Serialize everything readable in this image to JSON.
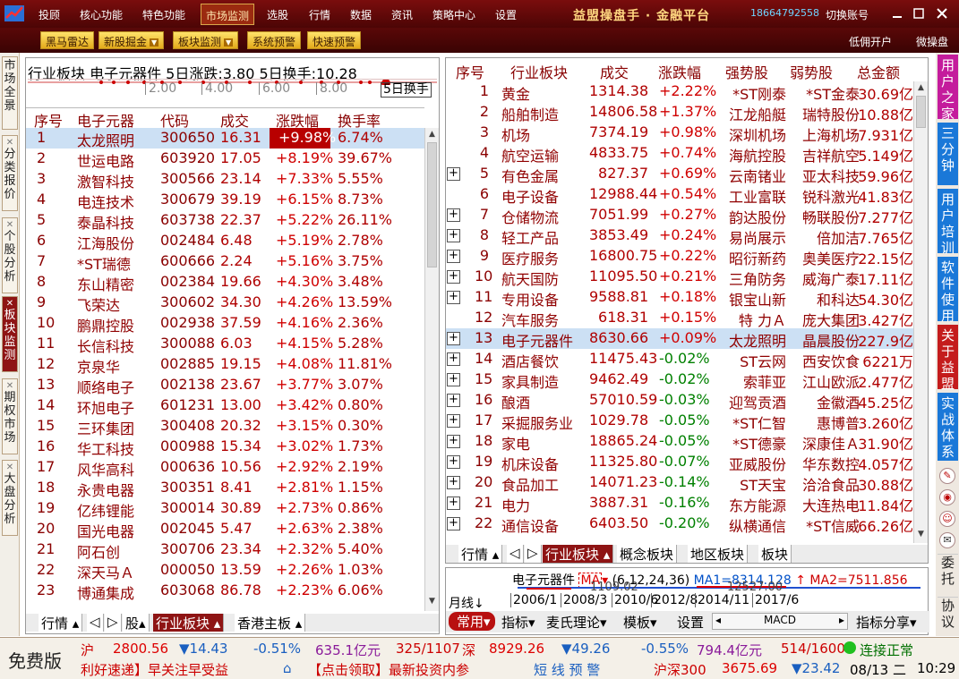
{
  "menubar": {
    "items": [
      "投顾",
      "核心功能",
      "特色功能",
      "市场监测",
      "选股",
      "行情",
      "数据",
      "资讯",
      "策略中心",
      "设置"
    ],
    "active": "市场监测",
    "brand": "益盟操盘手 · 金融平台",
    "phone": "18664792558",
    "account": "切换账号"
  },
  "toolbar": {
    "buttons": [
      "黑马雷达",
      "新股掘金",
      "板块监测",
      "系统预警",
      "快速预警"
    ],
    "right": [
      "低佣开户",
      "微操盘"
    ]
  },
  "left_tabs": [
    {
      "label": "市场全景",
      "active": false
    },
    {
      "label": "分类报价",
      "active": false
    },
    {
      "label": "个股分析",
      "active": false
    },
    {
      "label": "板块监测",
      "active": true
    },
    {
      "label": "期权市场",
      "active": false
    },
    {
      "label": "大盘分析",
      "active": false
    }
  ],
  "right_tabs": [
    "用户之家",
    "三分钟",
    "用户培训",
    "软件使用",
    "关于益盟",
    "实战体系"
  ],
  "right_bottom": [
    "委托",
    "协议"
  ],
  "left_panel": {
    "caption": "行业板块  电子元器件  5日涨跌:3.80  5日换手:10.28",
    "ticks": [
      "2.00",
      "4.00",
      "6.00",
      "8.00"
    ],
    "tick_label": "5日换手",
    "headers": [
      "序号",
      "电子元器",
      "代码",
      "成交",
      "涨跌幅",
      "换手率"
    ],
    "rows": [
      [
        "1",
        "太龙照明",
        "300650",
        "16.31",
        "+9.98%",
        "6.74%"
      ],
      [
        "2",
        "世运电路",
        "603920",
        "17.05",
        "+8.19%",
        "39.67%"
      ],
      [
        "3",
        "激智科技",
        "300566",
        "23.14",
        "+7.33%",
        "5.55%"
      ],
      [
        "4",
        "电连技术",
        "300679",
        "39.19",
        "+6.15%",
        "8.73%"
      ],
      [
        "5",
        "泰晶科技",
        "603738",
        "22.37",
        "+5.22%",
        "26.11%"
      ],
      [
        "6",
        "江海股份",
        "002484",
        "6.48",
        "+5.19%",
        "2.78%"
      ],
      [
        "7",
        "*ST瑞德",
        "600666",
        "2.24",
        "+5.16%",
        "3.75%"
      ],
      [
        "8",
        "东山精密",
        "002384",
        "19.66",
        "+4.30%",
        "3.48%"
      ],
      [
        "9",
        "飞荣达",
        "300602",
        "34.30",
        "+4.26%",
        "13.59%"
      ],
      [
        "10",
        "鹏鼎控股",
        "002938",
        "37.59",
        "+4.16%",
        "2.36%"
      ],
      [
        "11",
        "长信科技",
        "300088",
        "6.03",
        "+4.15%",
        "5.28%"
      ],
      [
        "12",
        "京泉华",
        "002885",
        "19.15",
        "+4.08%",
        "11.81%"
      ],
      [
        "13",
        "顺络电子",
        "002138",
        "23.67",
        "+3.77%",
        "3.07%"
      ],
      [
        "14",
        "环旭电子",
        "601231",
        "13.00",
        "+3.42%",
        "0.80%"
      ],
      [
        "15",
        "三环集团",
        "300408",
        "20.32",
        "+3.15%",
        "0.30%"
      ],
      [
        "16",
        "华工科技",
        "000988",
        "15.34",
        "+3.02%",
        "1.73%"
      ],
      [
        "17",
        "风华高科",
        "000636",
        "10.56",
        "+2.92%",
        "2.19%"
      ],
      [
        "18",
        "永贵电器",
        "300351",
        "8.41",
        "+2.81%",
        "1.15%"
      ],
      [
        "19",
        "亿纬锂能",
        "300014",
        "30.89",
        "+2.73%",
        "0.86%"
      ],
      [
        "20",
        "国光电器",
        "002045",
        "5.47",
        "+2.63%",
        "2.38%"
      ],
      [
        "21",
        "阿石创",
        "300706",
        "23.34",
        "+2.32%",
        "5.40%"
      ],
      [
        "22",
        "深天马Ａ",
        "000050",
        "13.59",
        "+2.26%",
        "1.03%"
      ],
      [
        "23",
        "博通集成",
        "603068",
        "86.78",
        "+2.23%",
        "6.06%"
      ]
    ],
    "tabs": [
      "行情",
      "股",
      "行业板块",
      "香港主板"
    ]
  },
  "right_panel": {
    "headers": [
      "序号",
      "行业板块",
      "成交",
      "涨跌幅",
      "强势股",
      "弱势股",
      "总金额"
    ],
    "rows": [
      [
        "1",
        "黄金",
        "1314.38",
        "+2.22%",
        "*ST刚泰",
        "*ST金泰",
        "30.69亿"
      ],
      [
        "2",
        "船舶制造",
        "14806.58",
        "+1.37%",
        "江龙船艇",
        "瑞特股份",
        "10.88亿"
      ],
      [
        "3",
        "机场",
        "7374.19",
        "+0.98%",
        "深圳机场",
        "上海机场",
        "7.931亿"
      ],
      [
        "4",
        "航空运输",
        "4833.75",
        "+0.74%",
        "海航控股",
        "吉祥航空",
        "5.149亿"
      ],
      [
        "5",
        "有色金属",
        "827.37",
        "+0.69%",
        "云南锗业",
        "亚太科技",
        "59.96亿"
      ],
      [
        "6",
        "电子设备",
        "12988.44",
        "+0.54%",
        "工业富联",
        "锐科激光",
        "41.83亿"
      ],
      [
        "7",
        "仓储物流",
        "7051.99",
        "+0.27%",
        "韵达股份",
        "畅联股份",
        "7.277亿"
      ],
      [
        "8",
        "轻工产品",
        "3853.49",
        "+0.24%",
        "易尚展示",
        "倍加洁",
        "7.765亿"
      ],
      [
        "9",
        "医疗服务",
        "16800.75",
        "+0.22%",
        "昭衍新药",
        "奥美医疗",
        "22.15亿"
      ],
      [
        "10",
        "航天国防",
        "11095.50",
        "+0.21%",
        "三角防务",
        "威海广泰",
        "17.11亿"
      ],
      [
        "11",
        "专用设备",
        "9588.81",
        "+0.18%",
        "银宝山新",
        "和科达",
        "54.30亿"
      ],
      [
        "12",
        "汽车服务",
        "618.31",
        "+0.15%",
        "特  力Ａ",
        "庞大集团",
        "3.427亿"
      ],
      [
        "13",
        "电子元器件",
        "8630.66",
        "+0.09%",
        "太龙照明",
        "晶晨股份",
        "227.9亿"
      ],
      [
        "14",
        "酒店餐饮",
        "11475.43",
        "-0.02%",
        "ST云网",
        "西安饮食",
        "6221万"
      ],
      [
        "15",
        "家具制造",
        "9462.49",
        "-0.02%",
        "索菲亚",
        "江山欧派",
        "2.477亿"
      ],
      [
        "16",
        "酿酒",
        "57010.59",
        "-0.03%",
        "迎驾贡酒",
        "金徽酒",
        "45.25亿"
      ],
      [
        "17",
        "采掘服务业",
        "1029.78",
        "-0.05%",
        "*ST仁智",
        "惠博普",
        "3.260亿"
      ],
      [
        "18",
        "家电",
        "18865.24",
        "-0.05%",
        "*ST德豪",
        "深康佳Ａ",
        "31.90亿"
      ],
      [
        "19",
        "机床设备",
        "11325.80",
        "-0.07%",
        "亚威股份",
        "华东数控",
        "4.057亿"
      ],
      [
        "20",
        "食品加工",
        "14071.23",
        "-0.14%",
        "ST天宝",
        "洽洽食品",
        "30.88亿"
      ],
      [
        "21",
        "电力",
        "3887.31",
        "-0.16%",
        "东方能源",
        "大连热电",
        "11.84亿"
      ],
      [
        "22",
        "通信设备",
        "6403.50",
        "-0.20%",
        "纵横通信",
        "*ST信威",
        "66.26亿"
      ]
    ],
    "tabs": [
      "行情",
      "概念板块",
      "行业板块",
      "地区板块",
      "板块"
    ]
  },
  "kline": {
    "name": "电子元器件",
    "ma_label": "MA",
    "ma_params": "(6,12,24,36)",
    "ma1": "MA1=8314.128",
    "ma2": "MA2=7511.856",
    "period": "月线",
    "val1": "1109.02",
    "val2": "12527.00",
    "dates": [
      "2006/1",
      "2008/3",
      "2010/6",
      "2012/8",
      "2014/11",
      "2017/6"
    ],
    "macd": "MACD",
    "tools": [
      "常用",
      "指标",
      "麦氏理论",
      "模板",
      "设置",
      "指标分享"
    ]
  },
  "status": {
    "free": "免费版",
    "sh_label": "沪",
    "sh_idx": "2800.56",
    "sh_chg": "▼14.43",
    "sh_pct": "-0.51%",
    "sh_amt": "635.1亿元",
    "sh_ratio": "325/1107",
    "sz_label": "深",
    "sz_idx": "8929.26",
    "sz_chg": "▼49.26",
    "sz_pct": "-0.55%",
    "sz_amt": "794.4亿元",
    "sz_ratio": "514/1600",
    "conn": "连接正常",
    "news1": "利好速递】早关注早受益",
    "news2": "【点击领取】最新投资内参",
    "warn": "短 线 预 警",
    "hs300_label": "沪深300",
    "hs300": "3675.69",
    "hs300_chg": "▼23.42",
    "date": "08/13 二",
    "time": "10:29"
  },
  "colors": {
    "brand_red": "#7a0d0d",
    "accent_red": "#b80000",
    "up": "#d00000",
    "down": "#008000",
    "selected": "#cce0f4"
  }
}
